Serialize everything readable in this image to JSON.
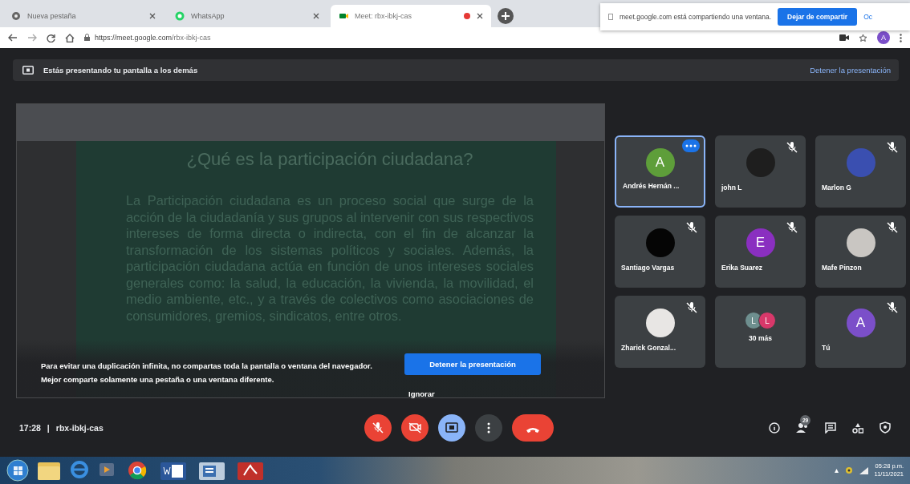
{
  "browser": {
    "tabs": [
      {
        "kind": "newtab",
        "title": "Nueva pestaña",
        "selected": false,
        "sharing": false
      },
      {
        "kind": "whatsapp",
        "title": "WhatsApp",
        "selected": false,
        "sharing": false
      },
      {
        "kind": "meet",
        "title": "Meet: rbx-ibkj-cas",
        "selected": true,
        "sharing": true
      }
    ],
    "url_host": "https://meet.google.com",
    "url_path": "/rbx-ibkj-cas",
    "profile_letter": "A",
    "share_notice": {
      "text": "meet.google.com está compartiendo una ventana.",
      "button": "Dejar de compartir",
      "cut_text": "Oc"
    }
  },
  "banner": {
    "text": "Estás presentando tu pantalla a los demás",
    "link": "Detener la presentación"
  },
  "preview": {
    "slide_title": "¿Qué es la participación ciudadana?",
    "slide_text": "La Participación ciudadana es un proceso social que surge de la acción de la ciudadanía y sus grupos al intervenir con sus respectivos intereses de forma directa o indirecta, con el fin de alcanzar la transformación de los sistemas políticos y sociales. Además, la participación ciudadana actúa en función de unos intereses sociales generales como: la salud, la educación, la vivienda, la movilidad, el medio ambiente, etc., y a través de colectivos como asociaciones de consumidores, gremios, sindicatos, entre otros.",
    "warning": "Para evitar una duplicación infinita, no compartas toda la pantalla o ventana del navegador. Mejor comparte solamente una pestaña o una ventana diferente.",
    "stop_button": "Detener la presentación",
    "dismiss": "Ignorar"
  },
  "tiles": [
    {
      "kind": "letter",
      "name": "Andrés Hernán ...",
      "letter": "A",
      "color": "#5e9e3a",
      "muted": false,
      "selected": true
    },
    {
      "kind": "photo",
      "name": "john L",
      "color": "#1e1e1e",
      "muted": true,
      "selected": false
    },
    {
      "kind": "photo",
      "name": "Marlon G",
      "color": "#3a4fb0",
      "muted": true,
      "selected": false
    },
    {
      "kind": "photo",
      "name": "Santiago Vargas",
      "color": "#050505",
      "muted": true,
      "selected": false
    },
    {
      "kind": "letter",
      "name": "Erika Suarez",
      "letter": "E",
      "color": "#8a2fc0",
      "muted": true,
      "selected": false
    },
    {
      "kind": "photo",
      "name": "Mafe Pinzon",
      "color": "#c9c6c2",
      "muted": true,
      "selected": false
    },
    {
      "kind": "photo",
      "name": "Zharick Gonzal...",
      "color": "#e8e6e4",
      "muted": true,
      "selected": false
    },
    {
      "kind": "more",
      "name": "30 más",
      "avatars": [
        {
          "letter": "L",
          "color": "#6e8f8f"
        },
        {
          "letter": "L",
          "color": "#d8386a"
        }
      ],
      "muted": false,
      "selected": false
    },
    {
      "kind": "letter",
      "name": "Tú",
      "letter": "A",
      "color": "#7b4fc9",
      "muted": true,
      "selected": false
    }
  ],
  "meeting_bar": {
    "time": "17:28",
    "separator": "|",
    "code": "rbx-ibkj-cas",
    "controls": [
      {
        "kind": "mic",
        "off": true
      },
      {
        "kind": "camera",
        "off": true
      },
      {
        "kind": "present",
        "off": false
      },
      {
        "kind": "more"
      },
      {
        "kind": "hangup"
      }
    ],
    "people_count": "29",
    "tools": [
      {
        "kind": "info"
      },
      {
        "kind": "people"
      },
      {
        "kind": "chat"
      },
      {
        "kind": "activities"
      },
      {
        "kind": "safety"
      }
    ]
  },
  "taskbar": {
    "apps": [
      {
        "kind": "start"
      },
      {
        "kind": "files"
      },
      {
        "kind": "ie"
      },
      {
        "kind": "media"
      },
      {
        "kind": "chrome"
      },
      {
        "kind": "word"
      },
      {
        "kind": "app"
      },
      {
        "kind": "pdf"
      }
    ],
    "time": "05:28 p.m.",
    "date": "11/11/2021"
  }
}
